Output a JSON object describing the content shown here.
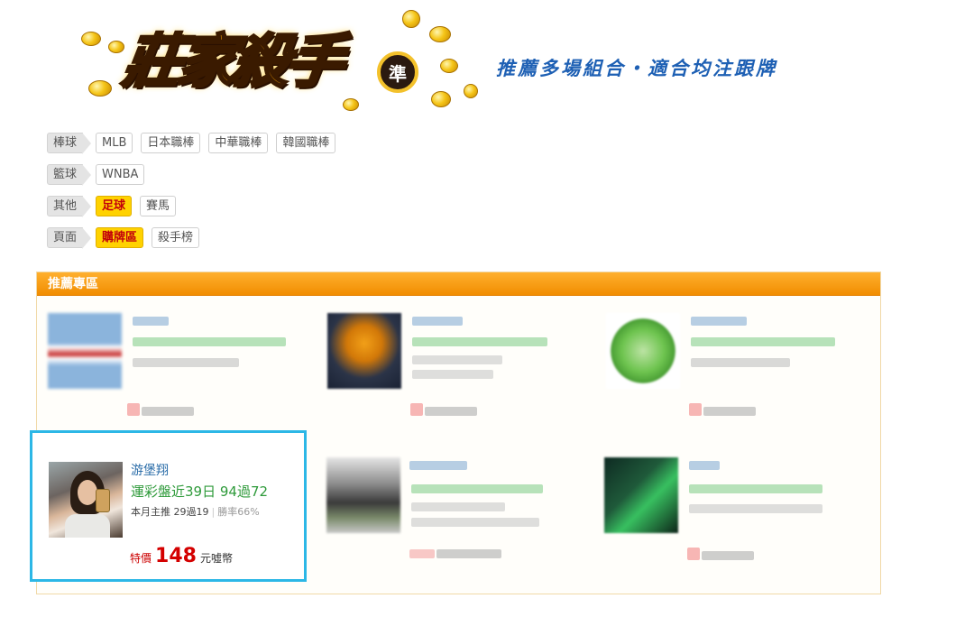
{
  "banner": {
    "logo_text": "莊家殺手",
    "logo_badge": "準",
    "slogan": "推薦多場組合・適合均注跟牌"
  },
  "filters": [
    {
      "category": "棒球",
      "options": [
        {
          "label": "MLB",
          "active": false
        },
        {
          "label": "日本職棒",
          "active": false
        },
        {
          "label": "中華職棒",
          "active": false
        },
        {
          "label": "韓國職棒",
          "active": false
        }
      ]
    },
    {
      "category": "籃球",
      "options": [
        {
          "label": "WNBA",
          "active": false
        }
      ]
    },
    {
      "category": "其他",
      "options": [
        {
          "label": "足球",
          "active": true
        },
        {
          "label": "賽馬",
          "active": false
        }
      ]
    },
    {
      "category": "頁面",
      "options": [
        {
          "label": "購牌區",
          "active": true
        },
        {
          "label": "殺手榜",
          "active": false
        }
      ]
    }
  ],
  "panel": {
    "title": "推薦專區"
  },
  "featured": {
    "name": "游堡翔",
    "record": "運彩盤近39日 94過72",
    "stat_label": "本月主推 29過19",
    "rate": "勝率66%",
    "price_label": "特價",
    "price_value": "148",
    "price_unit": "元噓幣"
  },
  "colors": {
    "accent_orange": "#f18d00",
    "highlight_border": "#2cb7e6",
    "active_option": "#ffd200",
    "price_red": "#d40000",
    "record_green": "#2e9a3a",
    "slogan_blue": "#1e60b4"
  }
}
